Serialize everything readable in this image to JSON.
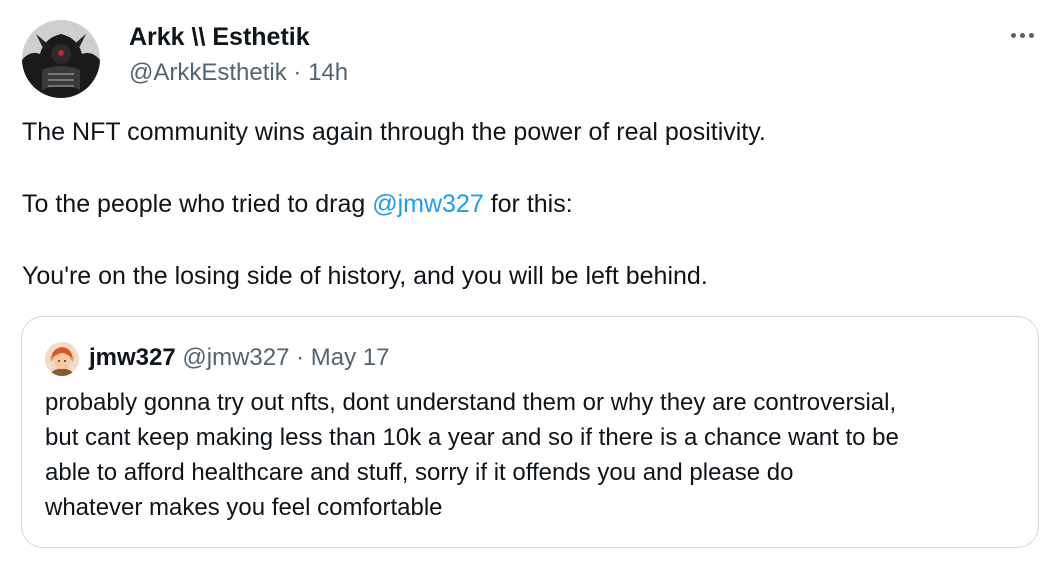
{
  "author": {
    "display_name": "Arkk \\\\ Esthetik",
    "handle": "@ArkkEsthetik",
    "separator": "·",
    "time": "14h"
  },
  "tweet": {
    "line1": "The NFT community wins again through the power of real positivity.",
    "line2_before": "To the people who tried to drag ",
    "line2_mention": "@jmw327",
    "line2_after": " for this:",
    "line3": "You're on the losing side of history, and you will be left behind."
  },
  "quoted": {
    "display_name": "jmw327",
    "handle": "@jmw327",
    "separator": "·",
    "date": "May 17",
    "lines": [
      "probably gonna try out nfts, dont understand them or why they are controversial,",
      "but cant keep making less than 10k a year and so if there is a chance want to be",
      "able to afford healthcare and stuff, sorry if it offends you and please do",
      "whatever makes you feel comfortable"
    ]
  },
  "icons": {
    "more": "more-horizontal-icon",
    "author_avatar": "avatar",
    "quoted_avatar": "quoted-avatar"
  },
  "colors": {
    "text": "#0f1419",
    "secondary": "#536471",
    "link": "#1d9bf0",
    "border": "#cfd9de"
  }
}
